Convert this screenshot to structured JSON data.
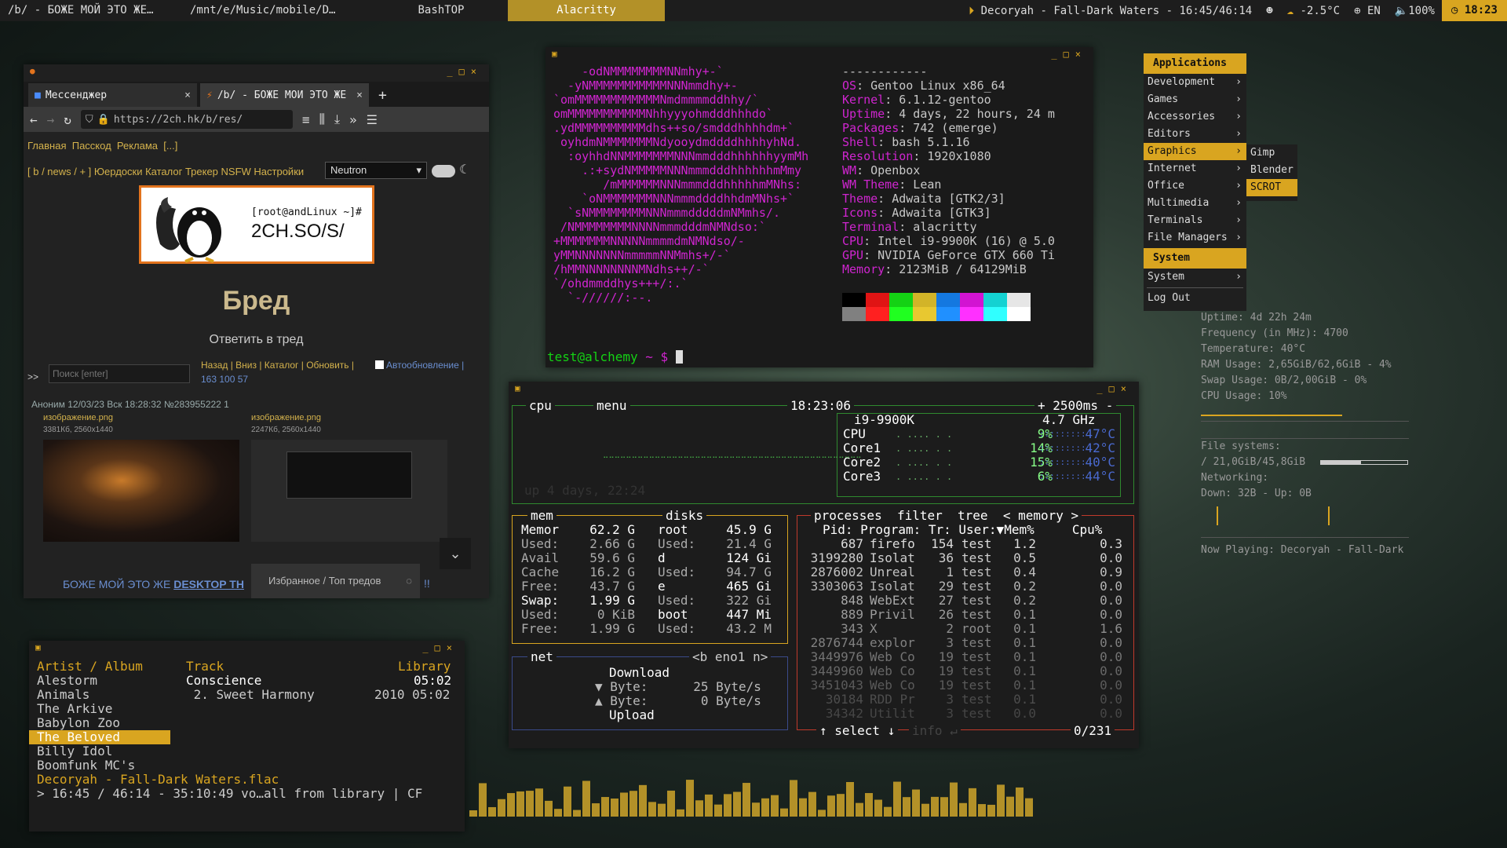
{
  "topbar": {
    "tasks": [
      "/b/ - БОЖЕ МОЙ ЭТО ЖЕ…",
      "/mnt/e/Music/mobile/D…",
      "BashTOP",
      "Alacritty"
    ],
    "now_playing": "Decoryah - Fall-Dark Waters - 16:45/46:14",
    "weather": "-2.5°C",
    "lang": "EN",
    "volume": "100%",
    "clock": "18:23"
  },
  "firefox": {
    "tab1": "Мессенджер",
    "tab2": "/b/ - БОЖЕ МОЙ ЭТО ЖЕ",
    "url": "https://2ch.hk/b/res/",
    "nav_links": [
      "Главная",
      "Пасскод",
      "Реклама",
      "[...]"
    ],
    "board_links": "[ b / news / + ] Юердоски Каталог Трекер NSFW Настройки",
    "theme_select": "Neutron",
    "logo_prompt": "[root@andLinux ~]#",
    "logo_text": "2CH.SO/S/",
    "board_title": "Бред",
    "reply": "Ответить в тред",
    "search_placeholder": "Поиск [enter]",
    "prefix": ">>",
    "actions": "Назад | Вниз | Каталог | Обновить |",
    "autoupdate": "Автообновление |",
    "stats": "163  100  57",
    "post_header": "Аноним  12/03/23 Вск 18:28:32  №283955222  1",
    "file1": "изображение.png",
    "file1_meta": "3381Кб, 2560x1440",
    "file2": "изображение.png",
    "file2_meta": "2247Кб, 2560x1440",
    "post_text": "БОЖЕ МОЙ ЭТО ЖЕ",
    "post_link": "DESKTOP TH",
    "post_tail": "!!",
    "popup": "Избранное / Топ тредов"
  },
  "neofetch": {
    "sep": "------------",
    "info": [
      [
        "OS",
        ": Gentoo Linux x86_64"
      ],
      [
        "Kernel",
        ": 6.1.12-gentoo"
      ],
      [
        "Uptime",
        ": 4 days, 22 hours, 24 m"
      ],
      [
        "Packages",
        ": 742 (emerge)"
      ],
      [
        "Shell",
        ": bash 5.1.16"
      ],
      [
        "Resolution",
        ": 1920x1080"
      ],
      [
        "WM",
        ": Openbox"
      ],
      [
        "WM Theme",
        ": Lean"
      ],
      [
        "Theme",
        ": Adwaita [GTK2/3]"
      ],
      [
        "Icons",
        ": Adwaita [GTK3]"
      ],
      [
        "Terminal",
        ": alacritty"
      ],
      [
        "CPU",
        ": Intel i9-9900K (16) @ 5.0"
      ],
      [
        "GPU",
        ": NVIDIA GeForce GTX 660 Ti"
      ],
      [
        "Memory",
        ": 2123MiB / 64129MiB"
      ]
    ],
    "prompt_user": "test@alchemy",
    "prompt_rest": " ~ $ ",
    "palette": [
      "#000000",
      "#e01414",
      "#14d214",
      "#d2b428",
      "#1478e0",
      "#d214d2",
      "#14d2d2",
      "#e6e6e6",
      "#808080",
      "#ff2020",
      "#20ff20",
      "#e8c830",
      "#2090ff",
      "#ff30ff",
      "#30ffff",
      "#ffffff"
    ]
  },
  "bashtop": {
    "cpu_label": "cpu",
    "menu_label": "menu",
    "time": "18:23:06",
    "interval": "+ 2500ms -",
    "cpu_model": "i9-9900K",
    "freq": "4.7 GHz",
    "cpu_rows": [
      [
        "CPU",
        "9%",
        "47°C"
      ],
      [
        "Core1",
        "14%",
        "42°C"
      ],
      [
        "Core2",
        "15%",
        "40°C"
      ],
      [
        "Core3",
        "6%",
        "44°C"
      ]
    ],
    "uptime": "up 4 days, 22:24",
    "mem_label": "mem",
    "disks_label": "disks",
    "mem_rows": [
      [
        "Memor",
        "62.2 G"
      ],
      [
        "Used:",
        "2.66 G"
      ],
      [
        "Avail",
        "59.6 G"
      ],
      [
        "Cache",
        "16.2 G"
      ],
      [
        "Free:",
        "43.7 G"
      ],
      [
        "Swap:",
        "1.99 G"
      ],
      [
        "Used:",
        "0 KiB"
      ],
      [
        "Free:",
        "1.99 G"
      ]
    ],
    "disk_rows": [
      [
        "root",
        "45.9 G"
      ],
      [
        "Used:",
        "21.4 G"
      ],
      [
        "d",
        "124 Gi"
      ],
      [
        "Used:",
        "94.7 G"
      ],
      [
        "e",
        "465 Gi"
      ],
      [
        "Used:",
        "322 Gi"
      ],
      [
        "boot",
        "447 Mi"
      ],
      [
        "Used:",
        "43.2 M"
      ]
    ],
    "net_label": "net",
    "net_iface": "<b eno1 n>",
    "net_rows": [
      "Download",
      "▼ Byte:      25 Byte/s",
      "▲ Byte:       0 Byte/s",
      "Upload"
    ],
    "proc_tabs": "processes  filter  tree  < memory >",
    "proc_header": "Pid: Program: Tr: User:▼Mem%     Cpu%",
    "procs": [
      [
        "687",
        "firefo",
        "154",
        "test",
        "1.2",
        "0.3"
      ],
      [
        "3199280",
        "Isolat",
        "36",
        "test",
        "0.5",
        "0.0"
      ],
      [
        "2876002",
        "Unreal",
        "1",
        "test",
        "0.4",
        "0.9"
      ],
      [
        "3303063",
        "Isolat",
        "29",
        "test",
        "0.2",
        "0.0"
      ],
      [
        "848",
        "WebExt",
        "27",
        "test",
        "0.2",
        "0.0"
      ],
      [
        "889",
        "Privil",
        "26",
        "test",
        "0.1",
        "0.0"
      ],
      [
        "343",
        "X",
        "2",
        "root",
        "0.1",
        "1.6"
      ],
      [
        "2876744",
        "explor",
        "3",
        "test",
        "0.1",
        "0.0"
      ],
      [
        "3449976",
        "Web Co",
        "19",
        "test",
        "0.1",
        "0.0"
      ],
      [
        "3449960",
        "Web Co",
        "19",
        "test",
        "0.1",
        "0.0"
      ],
      [
        "3451043",
        "Web Co",
        "19",
        "test",
        "0.1",
        "0.0"
      ],
      [
        "30184",
        "RDD Pr",
        "3",
        "test",
        "0.1",
        "0.0"
      ],
      [
        "34342",
        "Utilit",
        "3",
        "test",
        "0.0",
        "0.0"
      ]
    ],
    "select": "↑ select ↓",
    "info_label": "info ↵",
    "count": "0/231"
  },
  "music": {
    "col1": "Artist / Album",
    "col2": "Track",
    "col3": "Library",
    "artists": [
      "Alestorm",
      "Animals",
      "The Arkive",
      "Babylon Zoo",
      "The Beloved",
      "Billy Idol",
      "Boomfunk MC's"
    ],
    "selected_index": 4,
    "album": "Conscience",
    "album_time": "05:02",
    "track": " 2. Sweet Harmony",
    "track_meta": "2010 05:02",
    "now_file": "Decoryah - Fall-Dark Waters.flac",
    "status": "> 16:45 / 46:14 - 35:10:49 vo…all from library | CF"
  },
  "menu": {
    "header": "Applications",
    "items": [
      "Development",
      "Games",
      "Accessories",
      "Editors",
      "Graphics",
      "Internet",
      "Office",
      "Multimedia",
      "Terminals",
      "File Managers"
    ],
    "selected": 4,
    "system_header": "System",
    "system_item": "System",
    "logout": "Log Out",
    "sub": [
      "Gimp",
      "Blender",
      "SCROT"
    ]
  },
  "conky": {
    "lines": [
      "Uptime: 4d 22h 24m",
      "Frequency (in MHz): 4700",
      "Temperature: 40°C",
      "RAM Usage: 2,65GiB/62,6GiB - 4%",
      "Swap Usage: 0B/2,00GiB - 0%",
      "CPU Usage: 10%"
    ],
    "fs_title": "File systems:",
    "fs_line": " / 21,0GiB/45,8GiB",
    "fs_fraction": 0.46,
    "net_title": "Networking:",
    "net_line": "Down: 32B   -   Up: 0B",
    "now_playing": "Now Playing: Decoryah - Fall-Dark"
  }
}
